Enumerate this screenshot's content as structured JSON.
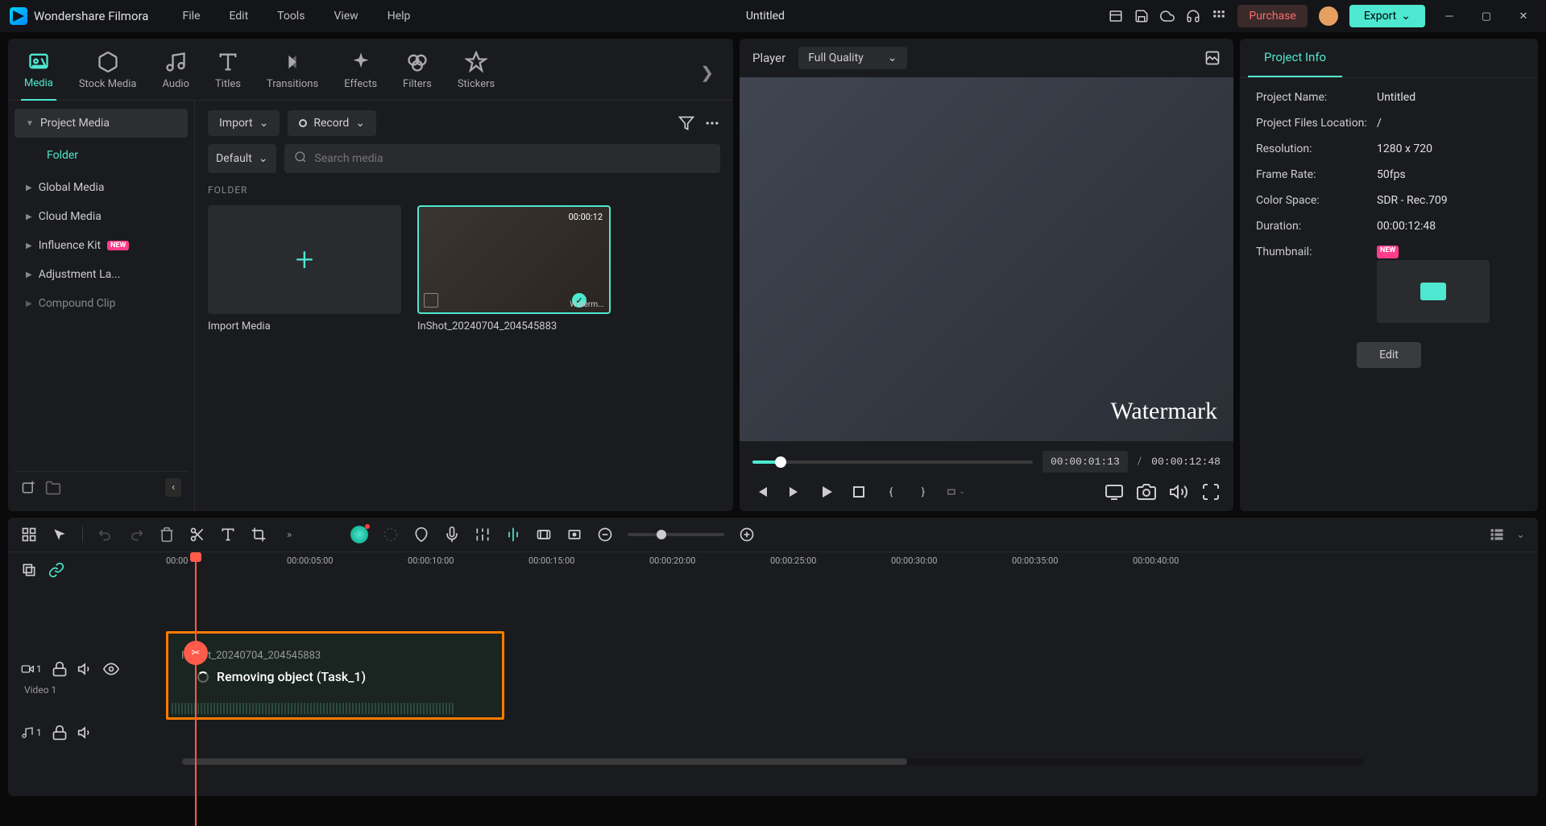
{
  "app": {
    "name": "Wondershare Filmora",
    "document": "Untitled"
  },
  "menubar": [
    "File",
    "Edit",
    "Tools",
    "View",
    "Help"
  ],
  "titlebar": {
    "purchase": "Purchase",
    "export": "Export"
  },
  "tabs": [
    {
      "id": "media",
      "label": "Media",
      "active": true
    },
    {
      "id": "stock",
      "label": "Stock Media"
    },
    {
      "id": "audio",
      "label": "Audio"
    },
    {
      "id": "titles",
      "label": "Titles"
    },
    {
      "id": "transitions",
      "label": "Transitions"
    },
    {
      "id": "effects",
      "label": "Effects"
    },
    {
      "id": "filters",
      "label": "Filters"
    },
    {
      "id": "stickers",
      "label": "Stickers"
    }
  ],
  "sidebar": {
    "items": [
      {
        "label": "Project Media",
        "active": true,
        "expanded": true
      },
      {
        "label": "Folder",
        "folder": true
      },
      {
        "label": "Global Media"
      },
      {
        "label": "Cloud Media"
      },
      {
        "label": "Influence Kit",
        "new": true
      },
      {
        "label": "Adjustment La..."
      },
      {
        "label": "Compound Clip"
      }
    ]
  },
  "mediaToolbar": {
    "import": "Import",
    "record": "Record",
    "sort": "Default",
    "searchPlaceholder": "Search media"
  },
  "folder": {
    "heading": "FOLDER",
    "importCard": "Import Media",
    "clip": {
      "name": "InShot_20240704_204545883",
      "duration": "00:00:12",
      "watermark": "Waterm..."
    }
  },
  "player": {
    "title": "Player",
    "quality": "Full Quality",
    "watermark": "Watermark",
    "currentTime": "00:00:01:13",
    "totalTime": "00:00:12:48",
    "separator": "/"
  },
  "projectInfo": {
    "tab": "Project Info",
    "rows": [
      {
        "label": "Project Name:",
        "value": "Untitled"
      },
      {
        "label": "Project Files Location:",
        "value": "/"
      },
      {
        "label": "Resolution:",
        "value": "1280 x 720"
      },
      {
        "label": "Frame Rate:",
        "value": "50fps"
      },
      {
        "label": "Color Space:",
        "value": "SDR - Rec.709"
      },
      {
        "label": "Duration:",
        "value": "00:00:12:48"
      }
    ],
    "thumbnailLabel": "Thumbnail:",
    "thumbnailNew": "NEW",
    "editBtn": "Edit"
  },
  "timeline": {
    "ruler": [
      "00:00",
      "00:00:05:00",
      "00:00:10:00",
      "00:00:15:00",
      "00:00:20:00",
      "00:00:25:00",
      "00:00:30:00",
      "00:00:35:00",
      "00:00:40:00"
    ],
    "videoTrack": {
      "index": "1",
      "name": "Video 1"
    },
    "audioTrack": {
      "index": "1"
    },
    "clip": {
      "filename": "InShot_20240704_204545883",
      "status": "Removing object (Task_1)"
    }
  }
}
